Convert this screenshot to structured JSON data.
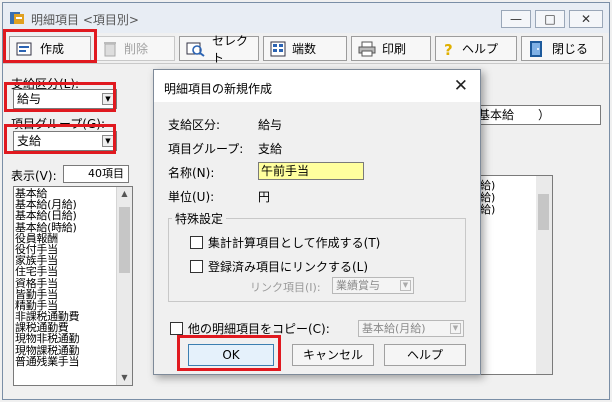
{
  "window": {
    "title": "明細項目 <項目別>",
    "controls": {
      "minimize": "—",
      "maximize": "□",
      "close": "✕"
    }
  },
  "toolbar": {
    "create": "作成",
    "delete": "削除",
    "select": "セレクト",
    "rounding": "端数",
    "print": "印刷",
    "help": "ヘルプ",
    "close": "閉じる"
  },
  "left": {
    "category_label": "支給区分(L):",
    "category_value": "給与",
    "group_label": "項目グループ(G):",
    "group_value": "支給",
    "display_label": "表示(V):",
    "display_count": "40項目",
    "items": [
      "基本給",
      "基本給(月給)",
      "基本給(日給)",
      "基本給(時給)",
      "役員報酬",
      "役付手当",
      "家族手当",
      "住宅手当",
      "資格手当",
      "皆勤手当",
      "精勤手当",
      "非課税通勤費",
      "課税通勤費",
      "現物非税通勤",
      "現物課税通勤",
      "普通残業手当"
    ]
  },
  "right": {
    "field_value": "基本給　　）",
    "items": [
      "給)",
      "給)",
      "給)"
    ]
  },
  "dialog": {
    "title": "明細項目の新規作成",
    "close": "✕",
    "category_label": "支給区分:",
    "category_value": "給与",
    "group_label": "項目グループ:",
    "group_value": "支給",
    "name_label": "名称(N):",
    "name_value": "午前手当",
    "unit_label": "単位(U):",
    "unit_value": "円",
    "special_title": "特殊設定",
    "aggregate_label": "集計計算項目として作成する(T)",
    "link_label": "登録済み項目にリンクする(L)",
    "link_item_label": "リンク項目(I):",
    "link_item_value": "業績賞与",
    "copy_label": "他の明細項目をコピー(C):",
    "copy_value": "基本給(月給)",
    "ok": "OK",
    "cancel": "キャンセル",
    "help": "ヘルプ"
  },
  "colors": {
    "highlight": "#e0191f",
    "name_input_bg": "#ffff9e"
  }
}
